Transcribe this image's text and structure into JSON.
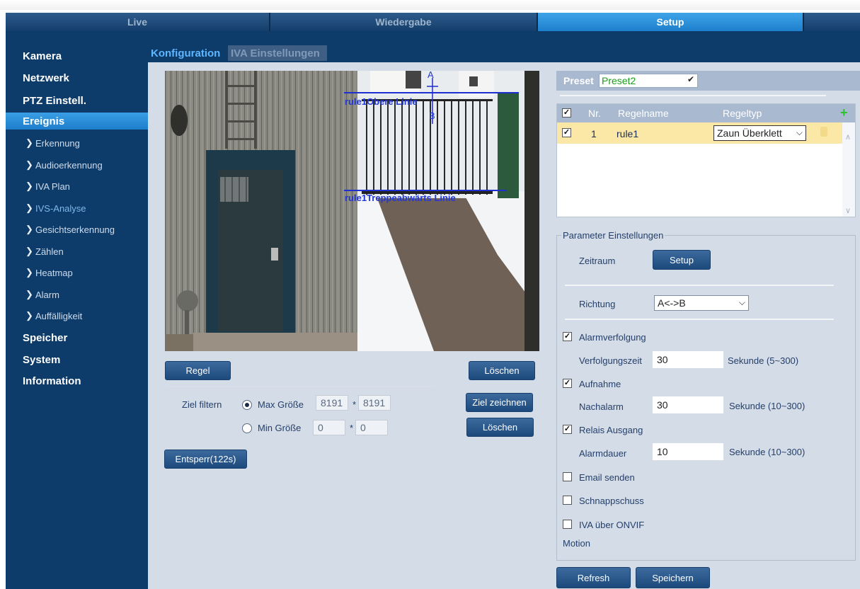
{
  "nav": {
    "tabs": [
      {
        "label": "Live"
      },
      {
        "label": "Wiedergabe"
      },
      {
        "label": "Setup"
      },
      {
        "label": ""
      }
    ]
  },
  "sidebar": {
    "items": [
      {
        "label": "Kamera"
      },
      {
        "label": "Netzwerk"
      },
      {
        "label": "PTZ Einstell."
      },
      {
        "label": "Ereignis"
      },
      {
        "label": "Speicher"
      },
      {
        "label": "System"
      },
      {
        "label": "Information"
      }
    ],
    "subitems": [
      {
        "label": "Erkennung"
      },
      {
        "label": "Audioerkennung"
      },
      {
        "label": "IVA Plan"
      },
      {
        "label": "IVS-Analyse"
      },
      {
        "label": "Gesichtserkennung"
      },
      {
        "label": "Zählen"
      },
      {
        "label": "Heatmap"
      },
      {
        "label": "Alarm"
      },
      {
        "label": "Auffälligkeit"
      }
    ]
  },
  "subtabs": {
    "config": "Konfiguration",
    "iva": "IVA Einstellungen"
  },
  "video": {
    "line1_label": "rule1Obere Linie",
    "line2_label": "rule1Treppeabwärts Linie",
    "dir_a": "A",
    "dir_b": "B"
  },
  "left": {
    "rule_button": "Regel",
    "delete_button": "Löschen",
    "target_filter": "Ziel filtern",
    "max_size_label": "Max Größe",
    "max_w": "8191",
    "max_h": "8191",
    "min_size_label": "Min Größe",
    "min_w": "0",
    "min_h": "0",
    "times": "*",
    "draw_target_button": "Ziel zeichnen",
    "delete_button2": "Löschen",
    "unlock_button": "Entsperr(122s)"
  },
  "preset": {
    "label": "Preset",
    "value": "Preset2"
  },
  "rules": {
    "headers": {
      "nr": "Nr.",
      "name": "Regelname",
      "type": "Regeltyp"
    },
    "rows": [
      {
        "nr": "1",
        "name": "rule1",
        "type": "Zaun Überklett"
      }
    ]
  },
  "params": {
    "legend": "Parameter Einstellungen",
    "period_label": "Zeitraum",
    "setup_button": "Setup",
    "direction_label": "Richtung",
    "direction_value": "A<->B",
    "alarm_tracking": "Alarmverfolgung",
    "tracking_time_label": "Verfolgungszeit",
    "tracking_time": "30",
    "tracking_unit": "Sekunde (5~300)",
    "record": "Aufnahme",
    "post_alarm_label": "Nachalarm",
    "post_alarm": "30",
    "post_alarm_unit": "Sekunde (10~300)",
    "relay_out": "Relais Ausgang",
    "alarm_duration_label": "Alarmdauer",
    "alarm_duration": "10",
    "alarm_duration_unit": "Sekunde (10~300)",
    "send_email": "Email senden",
    "snapshot": "Schnappschuss",
    "iva_onvif": "IVA über ONVIF",
    "motion": "Motion"
  },
  "footer": {
    "refresh": "Refresh",
    "save": "Speichern"
  },
  "checked": {
    "alarm_tracking": true,
    "record": true,
    "relay_out": true,
    "send_email": false,
    "snapshot": false,
    "iva_onvif": false
  }
}
